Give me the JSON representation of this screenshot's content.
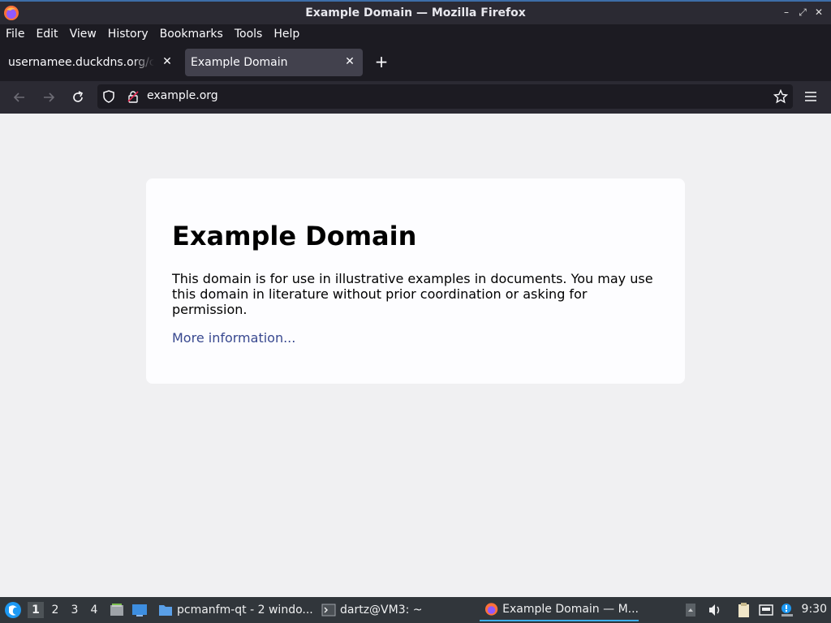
{
  "window": {
    "title": "Example Domain — Mozilla Firefox"
  },
  "menubar": {
    "items": [
      "File",
      "Edit",
      "View",
      "History",
      "Bookmarks",
      "Tools",
      "Help"
    ]
  },
  "tabs": [
    {
      "label": "usernamee.duckdns.org/cmd",
      "active": false
    },
    {
      "label": "Example Domain",
      "active": true
    }
  ],
  "navbar": {
    "url": "example.org"
  },
  "page": {
    "heading": "Example Domain",
    "description": "This domain is for use in illustrative examples in documents. You may use this domain in literature without prior coordination or asking for permission.",
    "link": "More information..."
  },
  "taskbar": {
    "desktops": [
      "1",
      "2",
      "3",
      "4"
    ],
    "tasks": [
      {
        "label": "pcmanfm-qt - 2 windo...",
        "icon": "folder-icon"
      },
      {
        "label": "dartz@VM3: ~",
        "icon": "terminal-icon"
      },
      {
        "label": "Example Domain — M...",
        "icon": "firefox-icon"
      }
    ],
    "clock": "9:30"
  },
  "colors": {
    "accent": "#3daee9",
    "link": "#38488f",
    "page_bg": "#f0f0f2"
  }
}
